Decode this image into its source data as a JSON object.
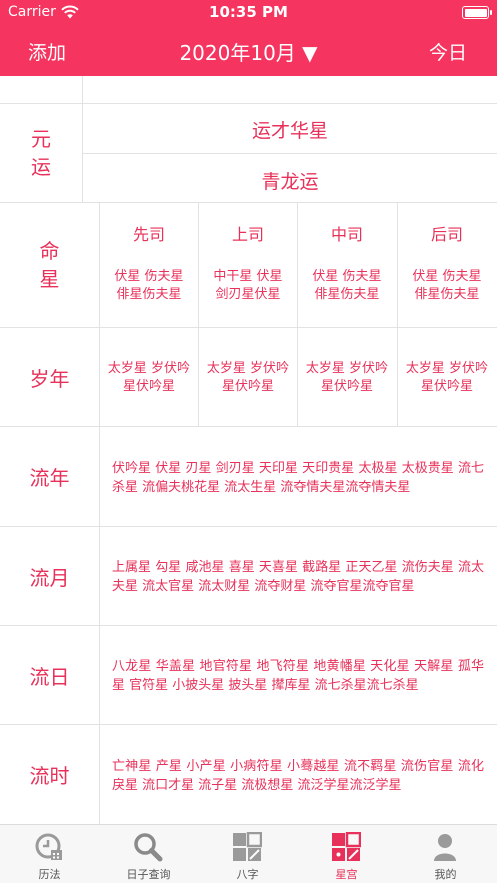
{
  "status_bar": {
    "carrier": "Carrier",
    "time": "10:35 PM"
  },
  "nav": {
    "add_label": "添加",
    "month_label": "2020年10月 ▼",
    "today_label": "今日"
  },
  "yuanyun": {
    "label_line1": "元",
    "label_line2": "运",
    "top": "运才华星",
    "bottom": "青龙运"
  },
  "mingxing": {
    "label_line1": "命",
    "label_line2": "星",
    "columns": [
      {
        "head": "先司",
        "text": "伏星 伤夫星 俳星伤夫星"
      },
      {
        "head": "上司",
        "text": "中干星 伏星 剑刃星伏星"
      },
      {
        "head": "中司",
        "text": "伏星 伤夫星 俳星伤夫星"
      },
      {
        "head": "后司",
        "text": "伏星 伤夫星 俳星伤夫星"
      }
    ]
  },
  "suinian": {
    "label": "岁年",
    "columns": [
      {
        "text": "太岁星 岁伏吟星伏吟星"
      },
      {
        "text": "太岁星 岁伏吟星伏吟星"
      },
      {
        "text": "太岁星 岁伏吟星伏吟星"
      },
      {
        "text": "太岁星 岁伏吟星伏吟星"
      }
    ]
  },
  "liunian": {
    "label": "流年",
    "text": "伏吟星 伏星 刃星 剑刃星 天印星 天印贵星 太极星 太极贵星 流七杀星 流偏夫桃花星 流太生星 流夺情夫星流夺情夫星"
  },
  "liuyue": {
    "label": "流月",
    "text": "上属星 勾星 咸池星 喜星 天喜星 截路星 正天乙星 流伤夫星 流太夫星 流太官星 流太财星 流夺财星 流夺官星流夺官星"
  },
  "liuri": {
    "label": "流日",
    "text": "八龙星 华盖星 地官符星 地飞符星 地黄幡星 天化星 天解星 孤华星 官符星 小披头星 披头星 撵库星 流七杀星流七杀星"
  },
  "liushi": {
    "label": "流时",
    "text": "亡神星 产星 小产星 小病符星 小蓦越星 流不羁星 流伤官星 流化戾星 流口才星 流子星 流极想星 流泛学星流泛学星"
  },
  "tabs": [
    {
      "label": "历法",
      "icon": "calendar-clock-icon",
      "active": false
    },
    {
      "label": "日子查询",
      "icon": "magnifier-icon",
      "active": false
    },
    {
      "label": "八字",
      "icon": "bazi-grid-icon",
      "active": false
    },
    {
      "label": "星宫",
      "icon": "star-palace-grid-icon",
      "active": true
    },
    {
      "label": "我的",
      "icon": "user-icon",
      "active": false
    }
  ],
  "colors": {
    "accent": "#f5345f",
    "text": "#e8315a",
    "tab_inactive": "#555555",
    "divider": "#e2e2e2"
  }
}
